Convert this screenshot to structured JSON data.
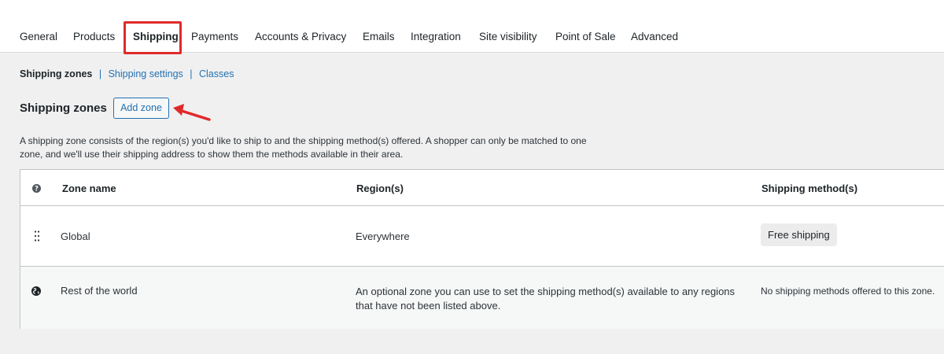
{
  "tabs": [
    {
      "label": "General"
    },
    {
      "label": "Products"
    },
    {
      "label": "Shipping",
      "active": true
    },
    {
      "label": "Payments"
    },
    {
      "label": "Accounts & Privacy"
    },
    {
      "label": "Emails"
    },
    {
      "label": "Integration"
    },
    {
      "label": "Site visibility"
    },
    {
      "label": "Point of Sale"
    },
    {
      "label": "Advanced"
    }
  ],
  "subnav": {
    "current": "Shipping zones",
    "links": [
      "Shipping settings",
      "Classes"
    ],
    "separator": "|"
  },
  "section": {
    "title": "Shipping zones",
    "add_button": "Add zone",
    "description": "A shipping zone consists of the region(s) you'd like to ship to and the shipping method(s) offered. A shopper can only be matched to one zone, and we'll use their shipping address to show them the methods available in their area."
  },
  "table": {
    "headers": {
      "name": "Zone name",
      "regions": "Region(s)",
      "methods": "Shipping method(s)"
    },
    "rows": [
      {
        "name": "Global",
        "regions": "Everywhere",
        "method": "Free shipping"
      },
      {
        "name": "Rest of the world",
        "regions": "An optional zone you can use to set the shipping method(s) available to any regions that have not been listed above.",
        "method": "No shipping methods offered to this zone."
      }
    ]
  },
  "colors": {
    "accent": "#2271b1",
    "highlight": "#e02a2a",
    "background": "#f0f0f1"
  },
  "icons": {
    "help": "help-circle-icon",
    "drag": "drag-handle-icon",
    "world": "globe-icon",
    "annotation": "red-arrow-icon"
  }
}
